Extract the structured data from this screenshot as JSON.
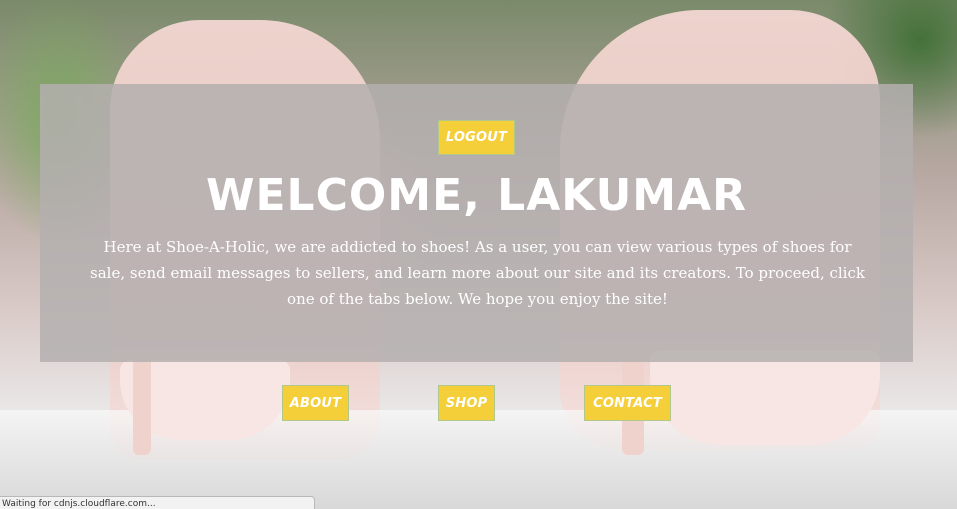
{
  "colors": {
    "button_bg": "#f4cf3a",
    "button_border": "#b2c78b",
    "panel_overlay": "rgba(180,175,175,0.85)",
    "text": "#ffffff"
  },
  "header": {
    "logout_label": "LOGOUT",
    "welcome_title": "WELCOME, LAKUMAR",
    "intro_text": "Here at Shoe-A-Holic, we are addicted to shoes! As a user, you can view various types of shoes for sale, send email messages to sellers, and learn more about our site and its creators. To proceed, click one of the tabs below. We hope you enjoy the site!"
  },
  "nav": {
    "about_label": "ABOUT",
    "shop_label": "SHOP",
    "contact_label": "CONTACT"
  },
  "status_bar": {
    "text": "Waiting for cdnjs.cloudflare.com..."
  }
}
